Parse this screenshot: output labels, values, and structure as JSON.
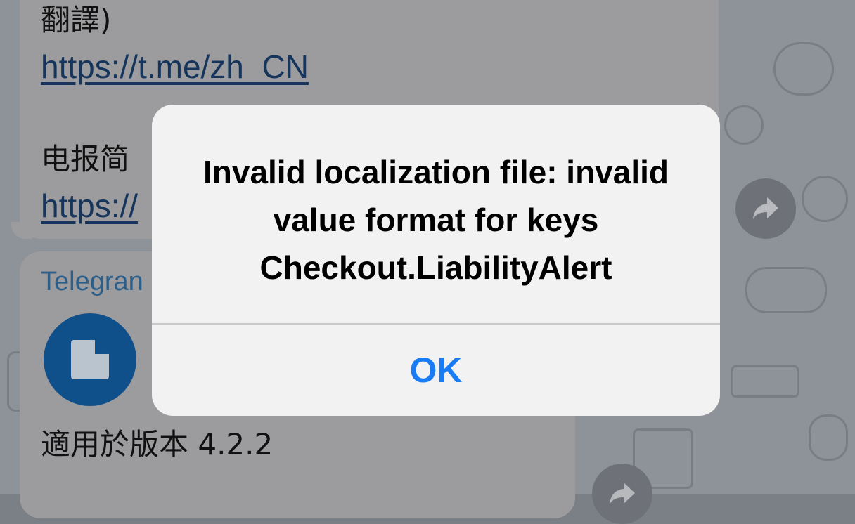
{
  "chat": {
    "msg1_line1": "翻譯)",
    "msg1_link1": "https://t.me/zh_CN",
    "msg1_line2": "电报简",
    "msg1_link2": "https://",
    "sender": "Telegran",
    "file_version": "適用於版本 4.2.2"
  },
  "alert": {
    "message_lines": [
      "Invalid localization file: invalid",
      "value format for keys",
      "Checkout.LiabilityAlert"
    ],
    "ok_label": "OK"
  },
  "colors": {
    "ok_blue": "#1a7cf5",
    "file_icon_blue": "#0f4f8a",
    "link_blue": "#16355c"
  },
  "icons": {
    "file": "file-icon",
    "share": "share-icon"
  }
}
